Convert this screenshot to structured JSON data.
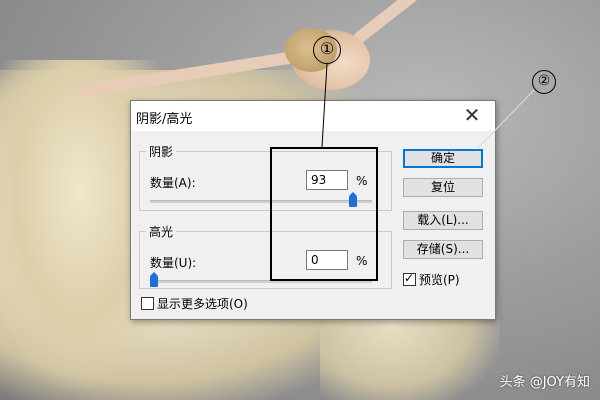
{
  "dialog": {
    "title": "阴影/高光",
    "close_glyph": "✕",
    "shadow": {
      "legend": "阴影",
      "amount_label": "数量(A):",
      "amount_value": "93",
      "unit": "%",
      "slider_fraction": 0.93
    },
    "highlight": {
      "legend": "高光",
      "amount_label": "数量(U):",
      "amount_value": "0",
      "unit": "%",
      "slider_fraction": 0.0
    },
    "buttons": {
      "ok": "确定",
      "reset": "复位",
      "load": "载入(L)...",
      "save": "存储(S)..."
    },
    "preview": {
      "label": "预览(P)",
      "checked": true
    },
    "more_options": {
      "label": "显示更多选项(O)",
      "checked": false
    }
  },
  "annotations": {
    "marker_1": "①",
    "marker_2": "②"
  },
  "watermark": "头条 @JOY有知",
  "colors": {
    "slider_thumb": "#1e6fd6",
    "ok_focus": "#0078d7"
  }
}
